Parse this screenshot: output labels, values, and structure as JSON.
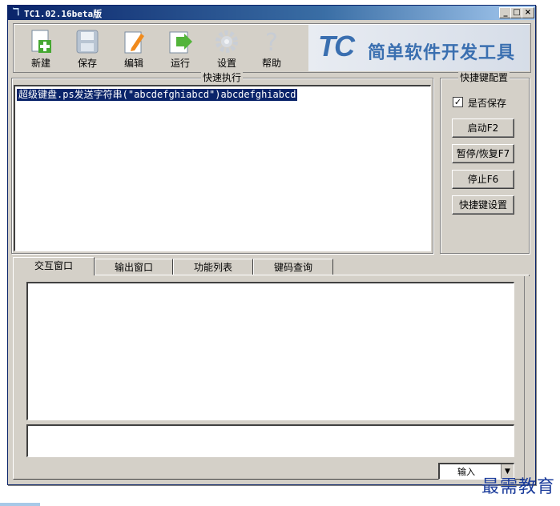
{
  "window": {
    "title": "TC1.02.16beta版"
  },
  "toolbar": {
    "items": [
      {
        "label": "新建",
        "icon": "new-file-icon"
      },
      {
        "label": "保存",
        "icon": "save-icon"
      },
      {
        "label": "编辑",
        "icon": "edit-icon"
      },
      {
        "label": "运行",
        "icon": "run-icon"
      },
      {
        "label": "设置",
        "icon": "gear-icon"
      },
      {
        "label": "帮助",
        "icon": "help-icon"
      }
    ],
    "banner_logo": "TC",
    "banner_text": "简单软件开发工具"
  },
  "quick_exec": {
    "title": "快速执行",
    "items": [
      "超级键盘.ps发送字符串(\"abcdefghiabcd\")abcdefghiabcd"
    ]
  },
  "hotkeys": {
    "title": "快捷键配置",
    "save_checkbox_label": "是否保存",
    "save_checked": true,
    "buttons": [
      "启动F2",
      "暂停/恢复F7",
      "停止F6",
      "快捷键设置"
    ]
  },
  "tabs": [
    "交互窗口",
    "输出窗口",
    "功能列表",
    "键码查询"
  ],
  "bottom": {
    "combo_value": "输入"
  },
  "watermark": "最需教育",
  "colors": {
    "selection": "#0a246a",
    "titlebar": "#0a246a",
    "banner_text": "#3a6fb0",
    "face": "#d4d0c8"
  }
}
